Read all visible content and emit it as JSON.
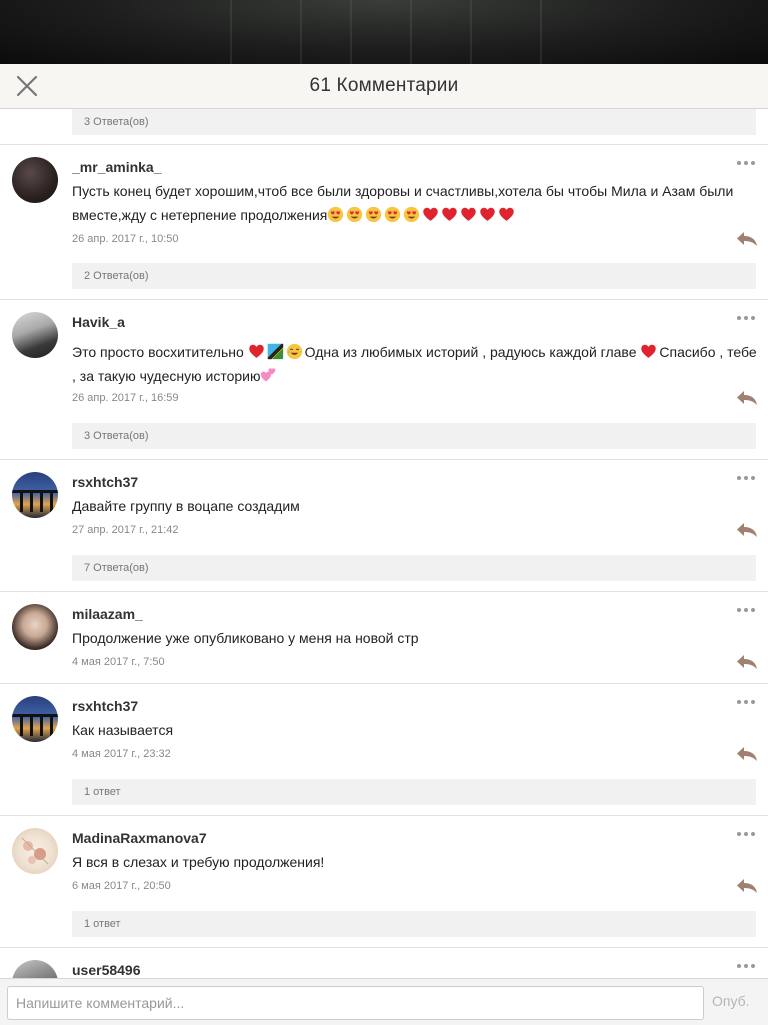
{
  "header": {
    "title": "61 Комментарии",
    "close_icon": "close-icon"
  },
  "top_replies": {
    "label": "3 Ответа(ов)"
  },
  "comments": [
    {
      "username": "_mr_aminka_",
      "text_line1": "Пусть конец будет хорошим,чтоб все были здоровы и счастливы,хотела бы чтобы Мила и Азам были",
      "text_line2": "вместе,жду с нетерпение продолжения",
      "emojis": [
        "heart-eyes",
        "heart-eyes",
        "heart-eyes",
        "heart-eyes",
        "heart-eyes",
        "red-heart",
        "red-heart",
        "red-heart",
        "red-heart",
        "red-heart"
      ],
      "date": "26 апр. 2017 г., 10:50",
      "replies": "2 Ответа(ов)"
    },
    {
      "username": "Havik_a",
      "text_a": "Это просто восхитительно ",
      "text_b": "Одна из любимых историй , радуюсь каждой главе ",
      "text_c": "Спасибо , тебе",
      "text_line2": ",  за такую чудесную историю",
      "date": "26 апр. 2017 г., 16:59",
      "replies": "3 Ответа(ов)"
    },
    {
      "username": "rsxhtch37",
      "text": "Давайте группу в воцапе создадим",
      "date": "27 апр. 2017 г., 21:42",
      "replies": "7 Ответа(ов)"
    },
    {
      "username": "milaazam_",
      "text": "Продолжение уже опубликовано у меня на новой стр",
      "date": "4 мая 2017 г., 7:50"
    },
    {
      "username": "rsxhtch37",
      "text": "Как называется",
      "date": "4 мая 2017 г., 23:32",
      "replies": "1 ответ"
    },
    {
      "username": "MadinaRaxmanova7",
      "text": "Я вся в слезах и требую продолжения!",
      "date": "6 мая 2017 г., 20:50",
      "replies": "1 ответ"
    },
    {
      "username": "user58496"
    }
  ],
  "composer": {
    "placeholder": "Напишите комментарий...",
    "post_label": "Опуб."
  },
  "colors": {
    "accent_icon": "#a08070",
    "reply_bar_bg": "#f1f1f1",
    "divider": "#e2e2e2"
  }
}
